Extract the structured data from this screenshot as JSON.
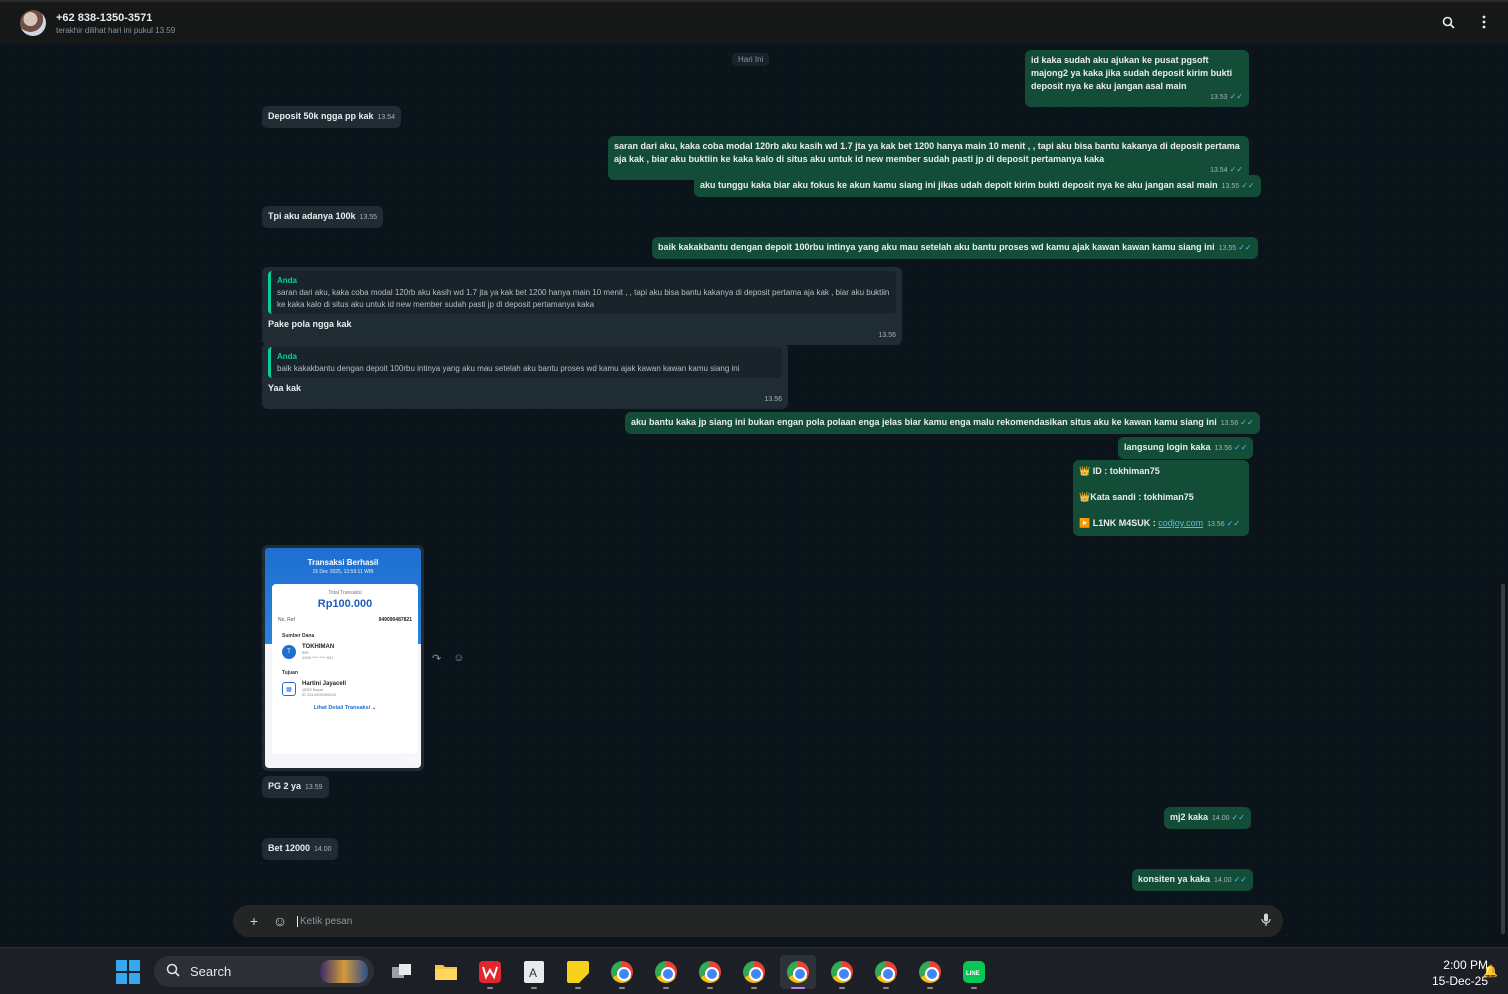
{
  "header": {
    "contact_name": "+62 838-1350-3571",
    "contact_status": "terakhir dilihat hari ini pukul 13.59",
    "search_icon": "search-icon",
    "menu_icon": "kebab-menu-icon"
  },
  "chat": {
    "day_label": "Hari Ini",
    "messages": [
      {
        "dir": "out",
        "text": "id kaka sudah aku ajukan ke pusat pgsoft majong2 ya kaka jika sudah deposit kirim bukti deposit nya ke aku jangan asal main",
        "time": "13.53"
      },
      {
        "dir": "in",
        "text": "Deposit 50k ngga pp kak",
        "time": "13.54"
      },
      {
        "dir": "out",
        "text": "saran dari aku, kaka coba modal 120rb aku kasih wd 1.7 jta ya kak bet 1200 hanya main 10 menit , , tapi aku bisa bantu kakanya di deposit pertama aja kak , biar aku buktiin ke kaka kalo di situs aku untuk id new member sudah pasti jp di deposit pertamanya kaka",
        "time": "13.54"
      },
      {
        "dir": "out",
        "text": "aku tunggu kaka biar aku fokus ke akun kamu siang ini jikas udah depoit kirim bukti deposit nya ke aku jangan asal main",
        "time": "13.55"
      },
      {
        "dir": "in",
        "text": "Tpi aku adanya 100k",
        "time": "13.55"
      },
      {
        "dir": "out",
        "text": "baik kakakbantu dengan depoit 100rbu intinya yang aku mau setelah aku bantu proses wd kamu ajak kawan kawan kamu siang ini",
        "time": "13.55"
      },
      {
        "dir": "in",
        "quote_author": "Anda",
        "quote_text": "saran dari aku, kaka coba modal 120rb aku kasih wd 1.7 jta ya kak bet 1200 hanya main 10 menit , , tapi aku bisa bantu kakanya di deposit pertama aja kak , biar aku buktiin ke kaka kalo di situs aku untuk id new member sudah pasti jp di deposit pertamanya kaka",
        "text": "Pake pola ngga kak",
        "time": "13.56"
      },
      {
        "dir": "in",
        "quote_author": "Anda",
        "quote_text": "baik kakakbantu dengan depoit 100rbu intinya yang aku mau setelah aku bantu proses wd kamu ajak kawan kawan kamu siang ini",
        "text": "Yaa kak",
        "time": "13.56"
      },
      {
        "dir": "out",
        "text": "aku bantu kaka jp siang ini bukan engan pola polaan enga jelas biar kamu enga malu rekomendasikan situs aku ke kawan kamu siang ini",
        "time": "13.56"
      },
      {
        "dir": "out",
        "text": "langsung login kaka",
        "time": "13.56"
      },
      {
        "dir": "out",
        "line1": "👑 ID :  tokhiman75",
        "line2": "👑Kata sandi : tokhiman75",
        "line3_prefix": "▶️ L1NK M4SUK : ",
        "link": "codjoy.com",
        "time": "13.56"
      },
      {
        "dir": "in",
        "text": "PG 2 ya",
        "time": "13.59"
      },
      {
        "dir": "out",
        "text": "mj2 kaka",
        "time": "14.00"
      },
      {
        "dir": "in",
        "text": "Bet 12000",
        "time": "14.00"
      },
      {
        "dir": "out",
        "text": "konsiten ya kaka",
        "time": "14.00"
      }
    ],
    "image_message": {
      "time": "13.59",
      "receipt": {
        "title": "Transaksi Berhasil",
        "date": "15 Dec 2025, 13:59:11 WIB",
        "total_label": "Total Transaksi",
        "total": "Rp100.000",
        "ref_label": "No. Ref",
        "ref_value": "949090487821",
        "source_label": "Sumber Dana",
        "source_name": "TOKHIMAN",
        "source_sub1": "BRI",
        "source_sub2": "4559 **** **** 531",
        "dest_label": "Tujuan",
        "dest_name": "Hartini Jayacell",
        "dest_sub1": "QRIS Bayar",
        "dest_sub2": "ID 2510200000543",
        "detail_link": "Lihat Detail Transaksi ⌄"
      }
    }
  },
  "composer": {
    "placeholder": "Ketik pesan",
    "plus_icon": "plus-icon",
    "sticker_icon": "sticker-icon",
    "mic_icon": "microphone-icon"
  },
  "taskbar": {
    "search_label": "Search",
    "time": "2:00 PM",
    "date": "15-Dec-25"
  }
}
